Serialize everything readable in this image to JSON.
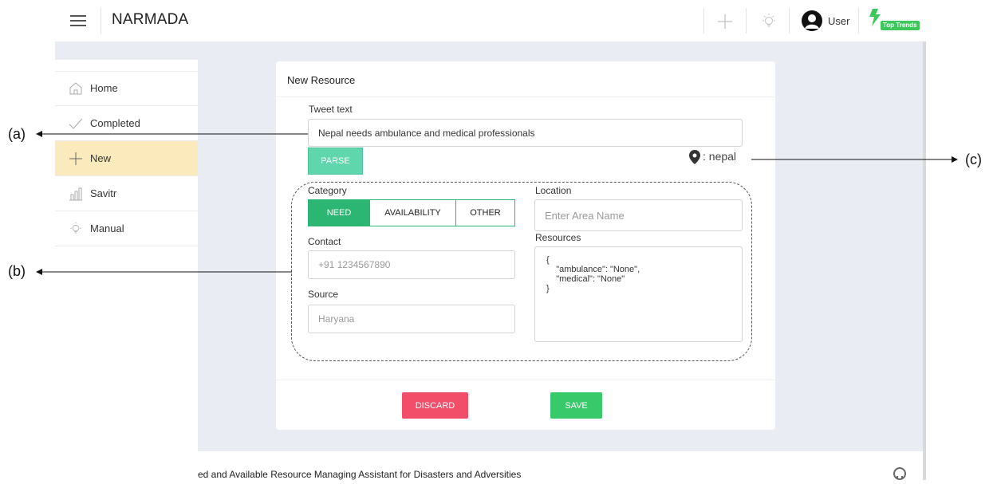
{
  "header": {
    "brand": "NARMADA",
    "user_label": "User",
    "badge_label": "Top Trends",
    "icons": [
      "menu-icon",
      "plus-icon",
      "lightbulb-icon",
      "user-avatar-icon",
      "bolt-icon"
    ]
  },
  "sidebar": {
    "items": [
      {
        "label": "Home",
        "icon": "home-icon"
      },
      {
        "label": "Completed",
        "icon": "checkmark-icon"
      },
      {
        "label": "New",
        "icon": "plus-icon",
        "active": true
      },
      {
        "label": "Savitr",
        "icon": "chart-icon"
      },
      {
        "label": "Manual",
        "icon": "lightbulb-icon"
      }
    ]
  },
  "form": {
    "title": "New Resource",
    "tweet_label": "Tweet text",
    "tweet_value": "Nepal needs ambulance and medical professionals",
    "parse_label": "PARSE",
    "location_result": ": nepal",
    "category_label": "Category",
    "categories": [
      "NEED",
      "AVAILABILITY",
      "OTHER"
    ],
    "selected_category": "NEED",
    "contact_label": "Contact",
    "contact_placeholder": "+91 1234567890",
    "source_label": "Source",
    "source_placeholder": "Haryana",
    "location_label": "Location",
    "location_placeholder": "Enter Area Name",
    "resources_label": "Resources",
    "resources_value": "{\n    \"ambulance\": \"None\",\n    \"medical\": \"None\"\n}",
    "discard_label": "DISCARD",
    "save_label": "SAVE"
  },
  "footer": {
    "text": "ed and Available Resource Managing Assistant for Disasters and Adversities"
  },
  "annotations": {
    "a": "(a)",
    "b": "(b)",
    "c": "(c)"
  },
  "colors": {
    "accent_green": "#2bb673",
    "parse": "#60d6ad",
    "discard": "#f24e6a",
    "save": "#37c96a",
    "active_nav": "#fbeabc",
    "page_bg": "#e9ecf2"
  }
}
